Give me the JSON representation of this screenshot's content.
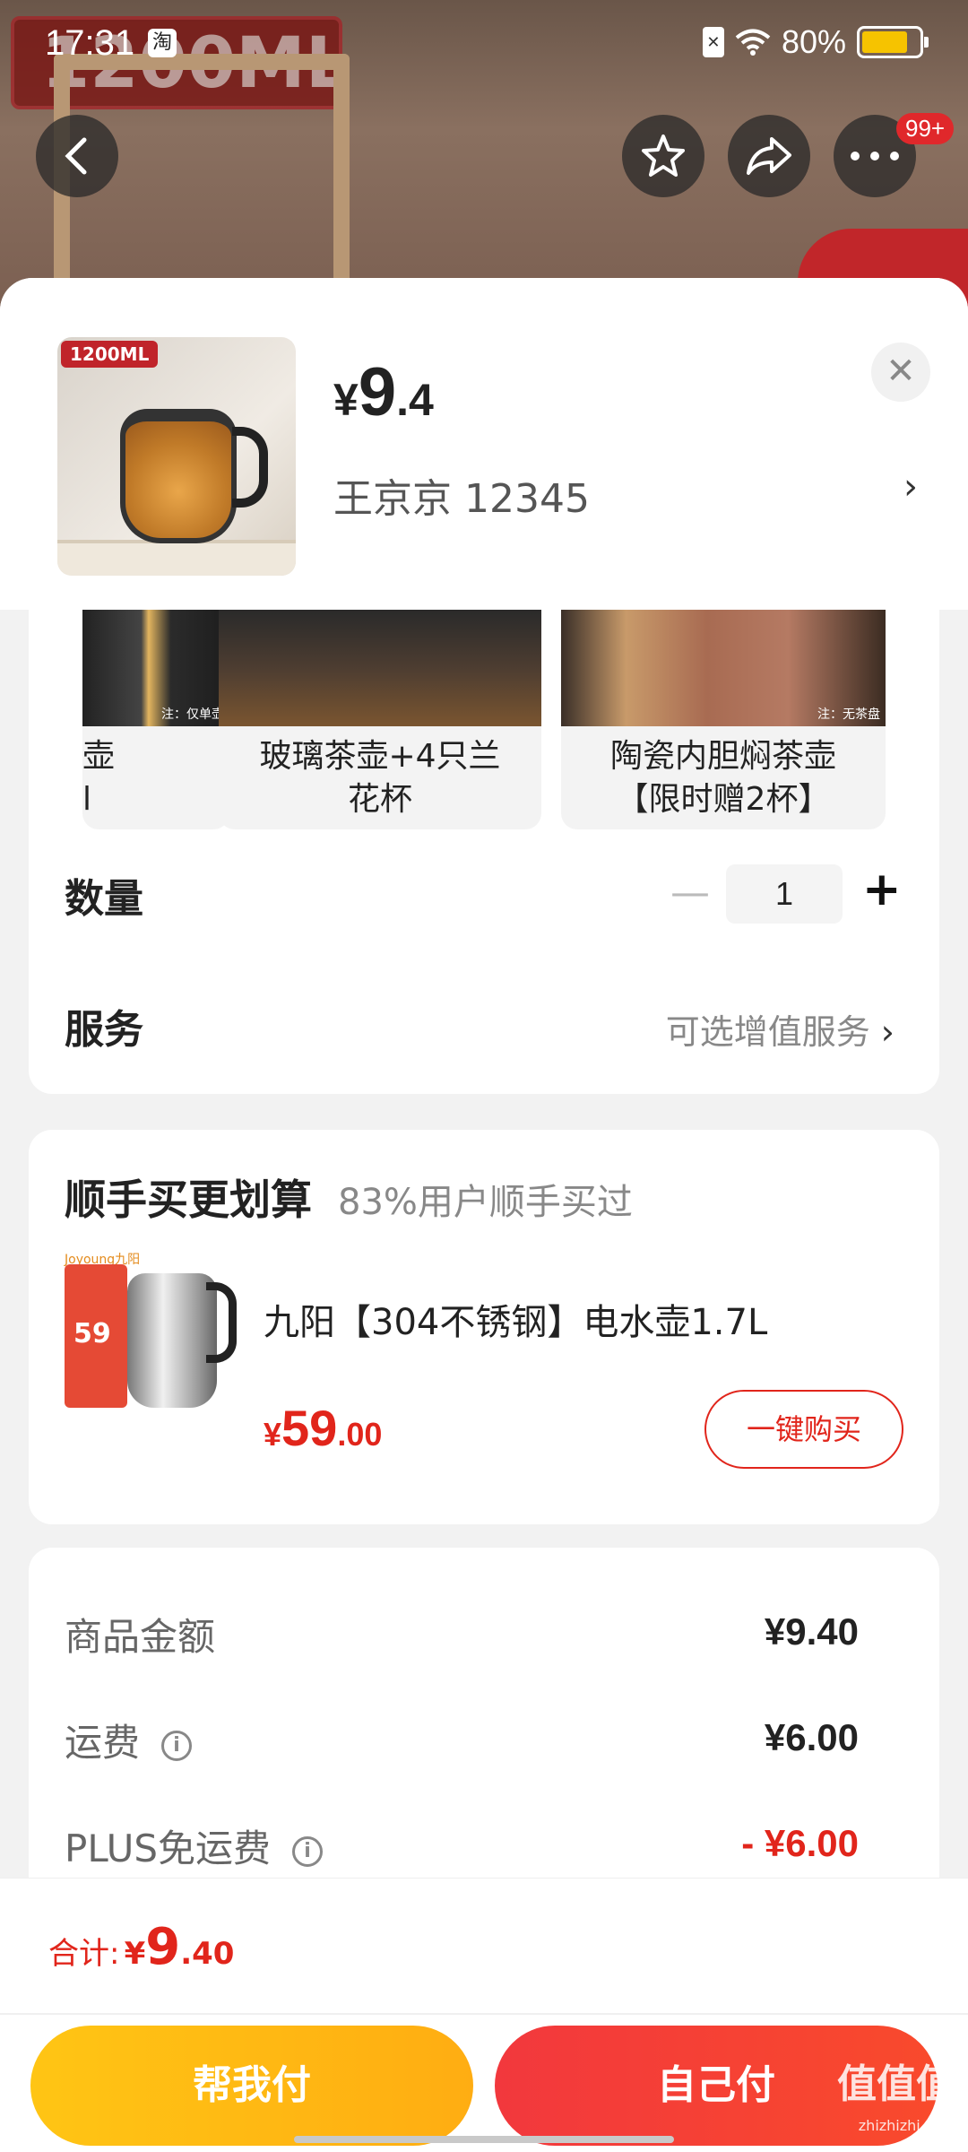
{
  "status_bar": {
    "time": "17:31",
    "app_icon": "淘",
    "battery": "80%"
  },
  "header": {
    "background_tag": "1200ML",
    "more_badge": "99+"
  },
  "product": {
    "thumb_label": "1200ML",
    "price_yen": "¥",
    "price_int": "9",
    "price_dec": ".4",
    "seller": "王京京  12345"
  },
  "options": [
    {
      "label": "壶\nl",
      "note": "注：仅单壶"
    },
    {
      "label": "玻璃茶壶+4只兰花杯",
      "note": ""
    },
    {
      "label": "陶瓷内胆焖茶壶【限时赠2杯】",
      "note": "注：无茶盘"
    }
  ],
  "quantity": {
    "label": "数量",
    "value": "1"
  },
  "service": {
    "label": "服务",
    "value": "可选增值服务"
  },
  "bundle": {
    "title": "顺手买更划算",
    "subtitle": "83%用户顺手买过",
    "brand": "Joyoung九阳",
    "pack_price": "59",
    "name": "九阳【304不锈钢】电水壶1.7L",
    "price_yen": "¥",
    "price_int": "59",
    "price_dec": ".00",
    "buy_label": "一键购买"
  },
  "amounts": [
    {
      "label": "商品金额",
      "value": "¥9.40",
      "info": false
    },
    {
      "label": "运费",
      "value": "¥6.00",
      "info": true
    },
    {
      "label": "PLUS免运费",
      "value": "- ¥6.00",
      "info": true
    }
  ],
  "footer": {
    "total_label": "合计:",
    "total_yen": "¥",
    "total_int": "9",
    "total_dec": ".40",
    "help_pay": "帮我付",
    "self_pay": "自己付"
  },
  "watermark": {
    "text": "值值值",
    "url": "zhizhizhi.com"
  },
  "colors": {
    "accent_red": "#e1251b",
    "help_btn": "#ffc514",
    "self_btn": "#f2383d"
  }
}
